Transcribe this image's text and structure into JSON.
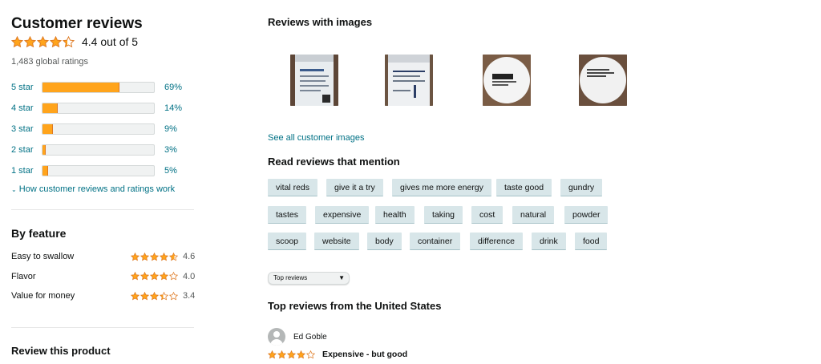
{
  "summary": {
    "title": "Customer reviews",
    "rating": 4.4,
    "rating_text": "4.4 out of 5",
    "global_ratings": "1,483 global ratings"
  },
  "histogram": [
    {
      "label": "5 star",
      "pct": "69%",
      "fraction": 0.69
    },
    {
      "label": "4 star",
      "pct": "14%",
      "fraction": 0.14
    },
    {
      "label": "3 star",
      "pct": "9%",
      "fraction": 0.09
    },
    {
      "label": "2 star",
      "pct": "3%",
      "fraction": 0.03
    },
    {
      "label": "1 star",
      "pct": "5%",
      "fraction": 0.05
    }
  ],
  "how_link": "How customer reviews and ratings work",
  "features": {
    "title": "By feature",
    "items": [
      {
        "name": "Easy to swallow",
        "rating": 4.6,
        "value": "4.6"
      },
      {
        "name": "Flavor",
        "rating": 4.0,
        "value": "4.0"
      },
      {
        "name": "Value for money",
        "rating": 3.4,
        "value": "3.4"
      }
    ]
  },
  "review_product_title": "Review this product",
  "images_section": {
    "title": "Reviews with images",
    "see_all": "See all customer images",
    "count": 4
  },
  "mentions": {
    "title": "Read reviews that mention",
    "rows": [
      [
        "vital reds",
        "give it a try",
        "gives me more energy",
        "taste good",
        "gundry"
      ],
      [
        "tastes",
        "expensive",
        "health",
        "taking",
        "cost",
        "natural",
        "powder"
      ],
      [
        "scoop",
        "website",
        "body",
        "container",
        "difference",
        "drink",
        "food"
      ]
    ]
  },
  "sort": {
    "selected": "Top reviews"
  },
  "top_reviews": {
    "title": "Top reviews from the United States",
    "first": {
      "reviewer": "Ed Goble",
      "rating": 4,
      "title": "Expensive - but good"
    }
  },
  "colors": {
    "star": "#ffa41c",
    "star_stroke": "#de7921",
    "link": "#007185",
    "chip_bg": "#d8e6e9"
  }
}
